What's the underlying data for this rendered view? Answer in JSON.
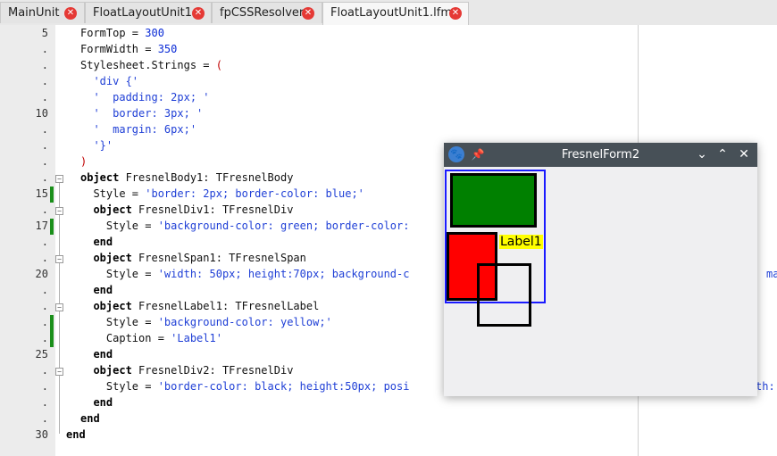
{
  "tabs": [
    {
      "label": "MainUnit",
      "active": false
    },
    {
      "label": "FloatLayoutUnit1",
      "active": false
    },
    {
      "label": "fpCSSResolver",
      "active": false
    },
    {
      "label": "FloatLayoutUnit1.lfm",
      "active": true
    }
  ],
  "editor": {
    "line_numbers": [
      "5",
      ".",
      ".",
      ".",
      ".",
      "10",
      ".",
      ".",
      ".",
      ".",
      "15",
      ".",
      "17",
      ".",
      ".",
      "20",
      ".",
      ".",
      ".",
      ".",
      "25",
      ".",
      ".",
      ".",
      ".",
      "30"
    ],
    "lines": [
      [
        {
          "t": "FormTop = ",
          "c": ""
        },
        {
          "t": "300",
          "c": "num"
        }
      ],
      [
        {
          "t": "FormWidth = ",
          "c": ""
        },
        {
          "t": "350",
          "c": "num"
        }
      ],
      [
        {
          "t": "Stylesheet.Strings = ",
          "c": ""
        },
        {
          "t": "(",
          "c": "sym"
        }
      ],
      [
        {
          "t": "  'div {'",
          "c": "str"
        }
      ],
      [
        {
          "t": "  '  padding: 2px; '",
          "c": "str"
        }
      ],
      [
        {
          "t": "  '  border: 3px; '",
          "c": "str"
        }
      ],
      [
        {
          "t": "  '  margin: 6px;'",
          "c": "str"
        }
      ],
      [
        {
          "t": "  '}'",
          "c": "str"
        }
      ],
      [
        {
          "t": ")",
          "c": "sym"
        }
      ],
      [
        {
          "t": "object",
          "c": "kw"
        },
        {
          "t": " FresnelBody1: TFresnelBody",
          "c": ""
        }
      ],
      [
        {
          "t": "  Style = ",
          "c": ""
        },
        {
          "t": "'border: 2px; border-color: blue;'",
          "c": "str"
        }
      ],
      [
        {
          "t": "  object",
          "c": "kw"
        },
        {
          "t": " FresnelDiv1: TFresnelDiv",
          "c": ""
        }
      ],
      [
        {
          "t": "    Style = ",
          "c": ""
        },
        {
          "t": "'background-color: green; border-color:",
          "c": "str"
        }
      ],
      [
        {
          "t": "  end",
          "c": "kw"
        }
      ],
      [
        {
          "t": "  object",
          "c": "kw"
        },
        {
          "t": " FresnelSpan1: TFresnelSpan",
          "c": ""
        }
      ],
      [
        {
          "t": "    Style = ",
          "c": ""
        },
        {
          "t": "'width: 50px; height:70px; background-c",
          "c": "str"
        }
      ],
      [
        {
          "t": "  end",
          "c": "kw"
        }
      ],
      [
        {
          "t": "  object",
          "c": "kw"
        },
        {
          "t": " FresnelLabel1: TFresnelLabel",
          "c": ""
        }
      ],
      [
        {
          "t": "    Style = ",
          "c": ""
        },
        {
          "t": "'background-color: yellow;'",
          "c": "str"
        }
      ],
      [
        {
          "t": "    Caption = ",
          "c": ""
        },
        {
          "t": "'Label1'",
          "c": "str"
        }
      ],
      [
        {
          "t": "  end",
          "c": "kw"
        }
      ],
      [
        {
          "t": "  object",
          "c": "kw"
        },
        {
          "t": " FresnelDiv2: TFresnelDiv",
          "c": ""
        }
      ],
      [
        {
          "t": "    Style = ",
          "c": ""
        },
        {
          "t": "'border-color: black; height:50px; posi",
          "c": "str"
        }
      ],
      [
        {
          "t": "  end",
          "c": "kw"
        }
      ],
      [
        {
          "t": "end",
          "c": "kw"
        }
      ],
      [
        {
          "t": "end",
          "c": "kw"
        }
      ]
    ],
    "overflow_fragments": {
      "line20": "ma",
      "line27": "th:"
    }
  },
  "window": {
    "title": "FresnelForm2",
    "icons": {
      "app": "lazarus-paw-icon",
      "pin": "pin-icon",
      "minimize": "minimize-icon",
      "maximize": "maximize-icon",
      "close": "close-icon"
    },
    "label_caption": "Label1",
    "colors": {
      "body_border": "#1a1aff",
      "div1_bg": "#008000",
      "span1_bg": "#ff0000",
      "label_bg": "#ffff00"
    }
  }
}
